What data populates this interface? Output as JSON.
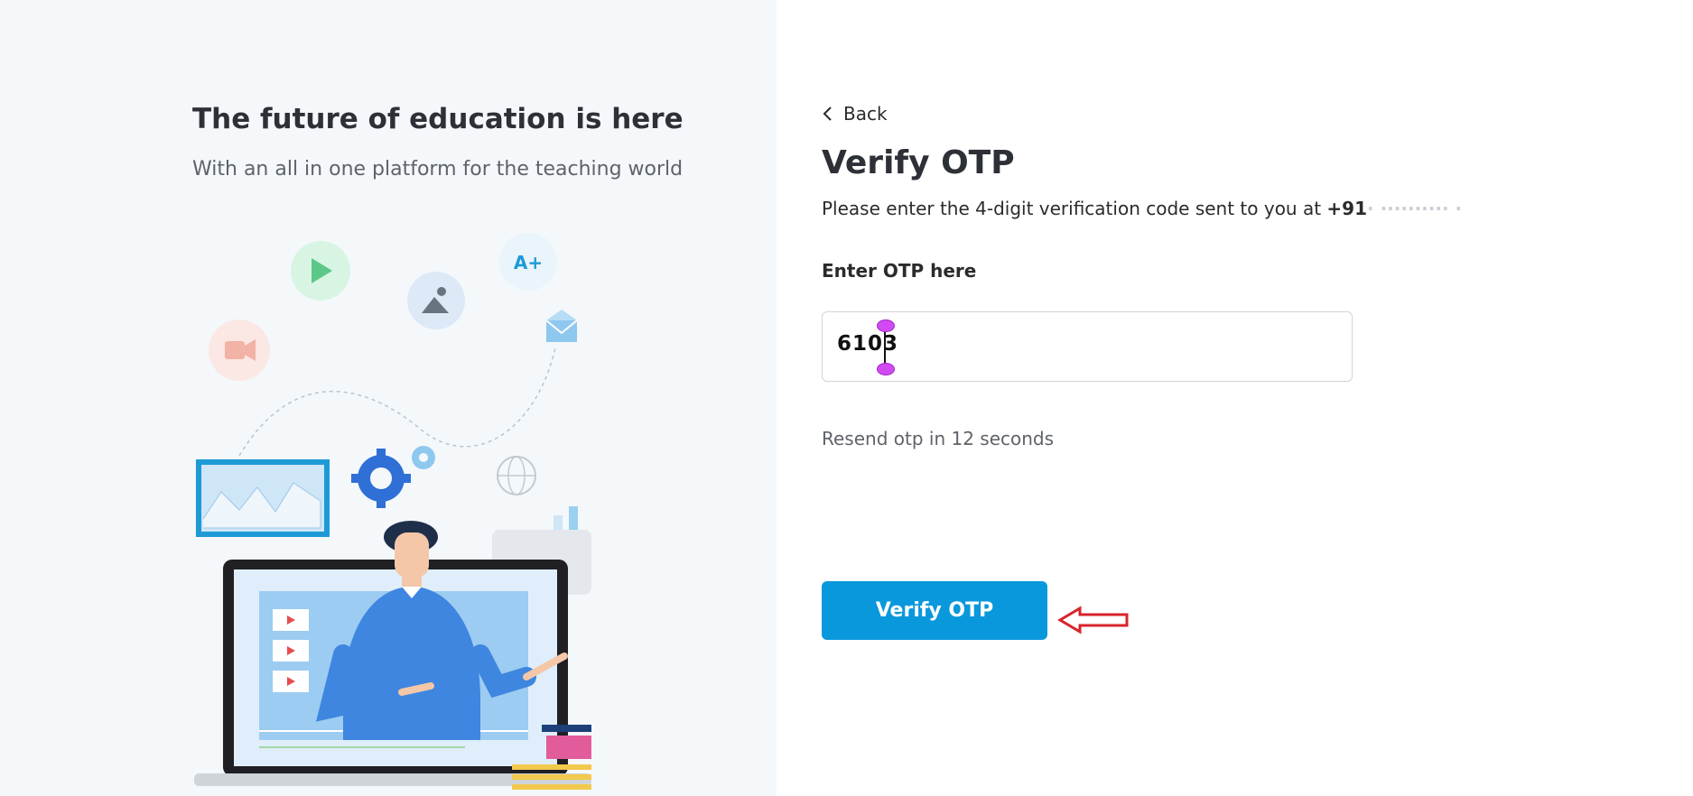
{
  "hero": {
    "title": "The future of education is here",
    "subtitle": "With an all in one platform for the teaching world",
    "badge_text": "A+"
  },
  "back": {
    "label": "Back"
  },
  "page_title": "Verify OTP",
  "instruction": {
    "text": "Please enter the 4-digit verification code sent to you at ",
    "phone_prefix": "+91",
    "phone_masked": "· ·········· ·"
  },
  "otp": {
    "label": "Enter OTP here",
    "value": "6103"
  },
  "resend": {
    "text": "Resend otp in 12 seconds"
  },
  "verify_button": {
    "label": "Verify OTP"
  },
  "colors": {
    "primary": "#0a98dc",
    "left_panel_bg": "#f4f8fb",
    "annotation_arrow": "#d9232d",
    "cursor_handle": "#d24bf2"
  }
}
